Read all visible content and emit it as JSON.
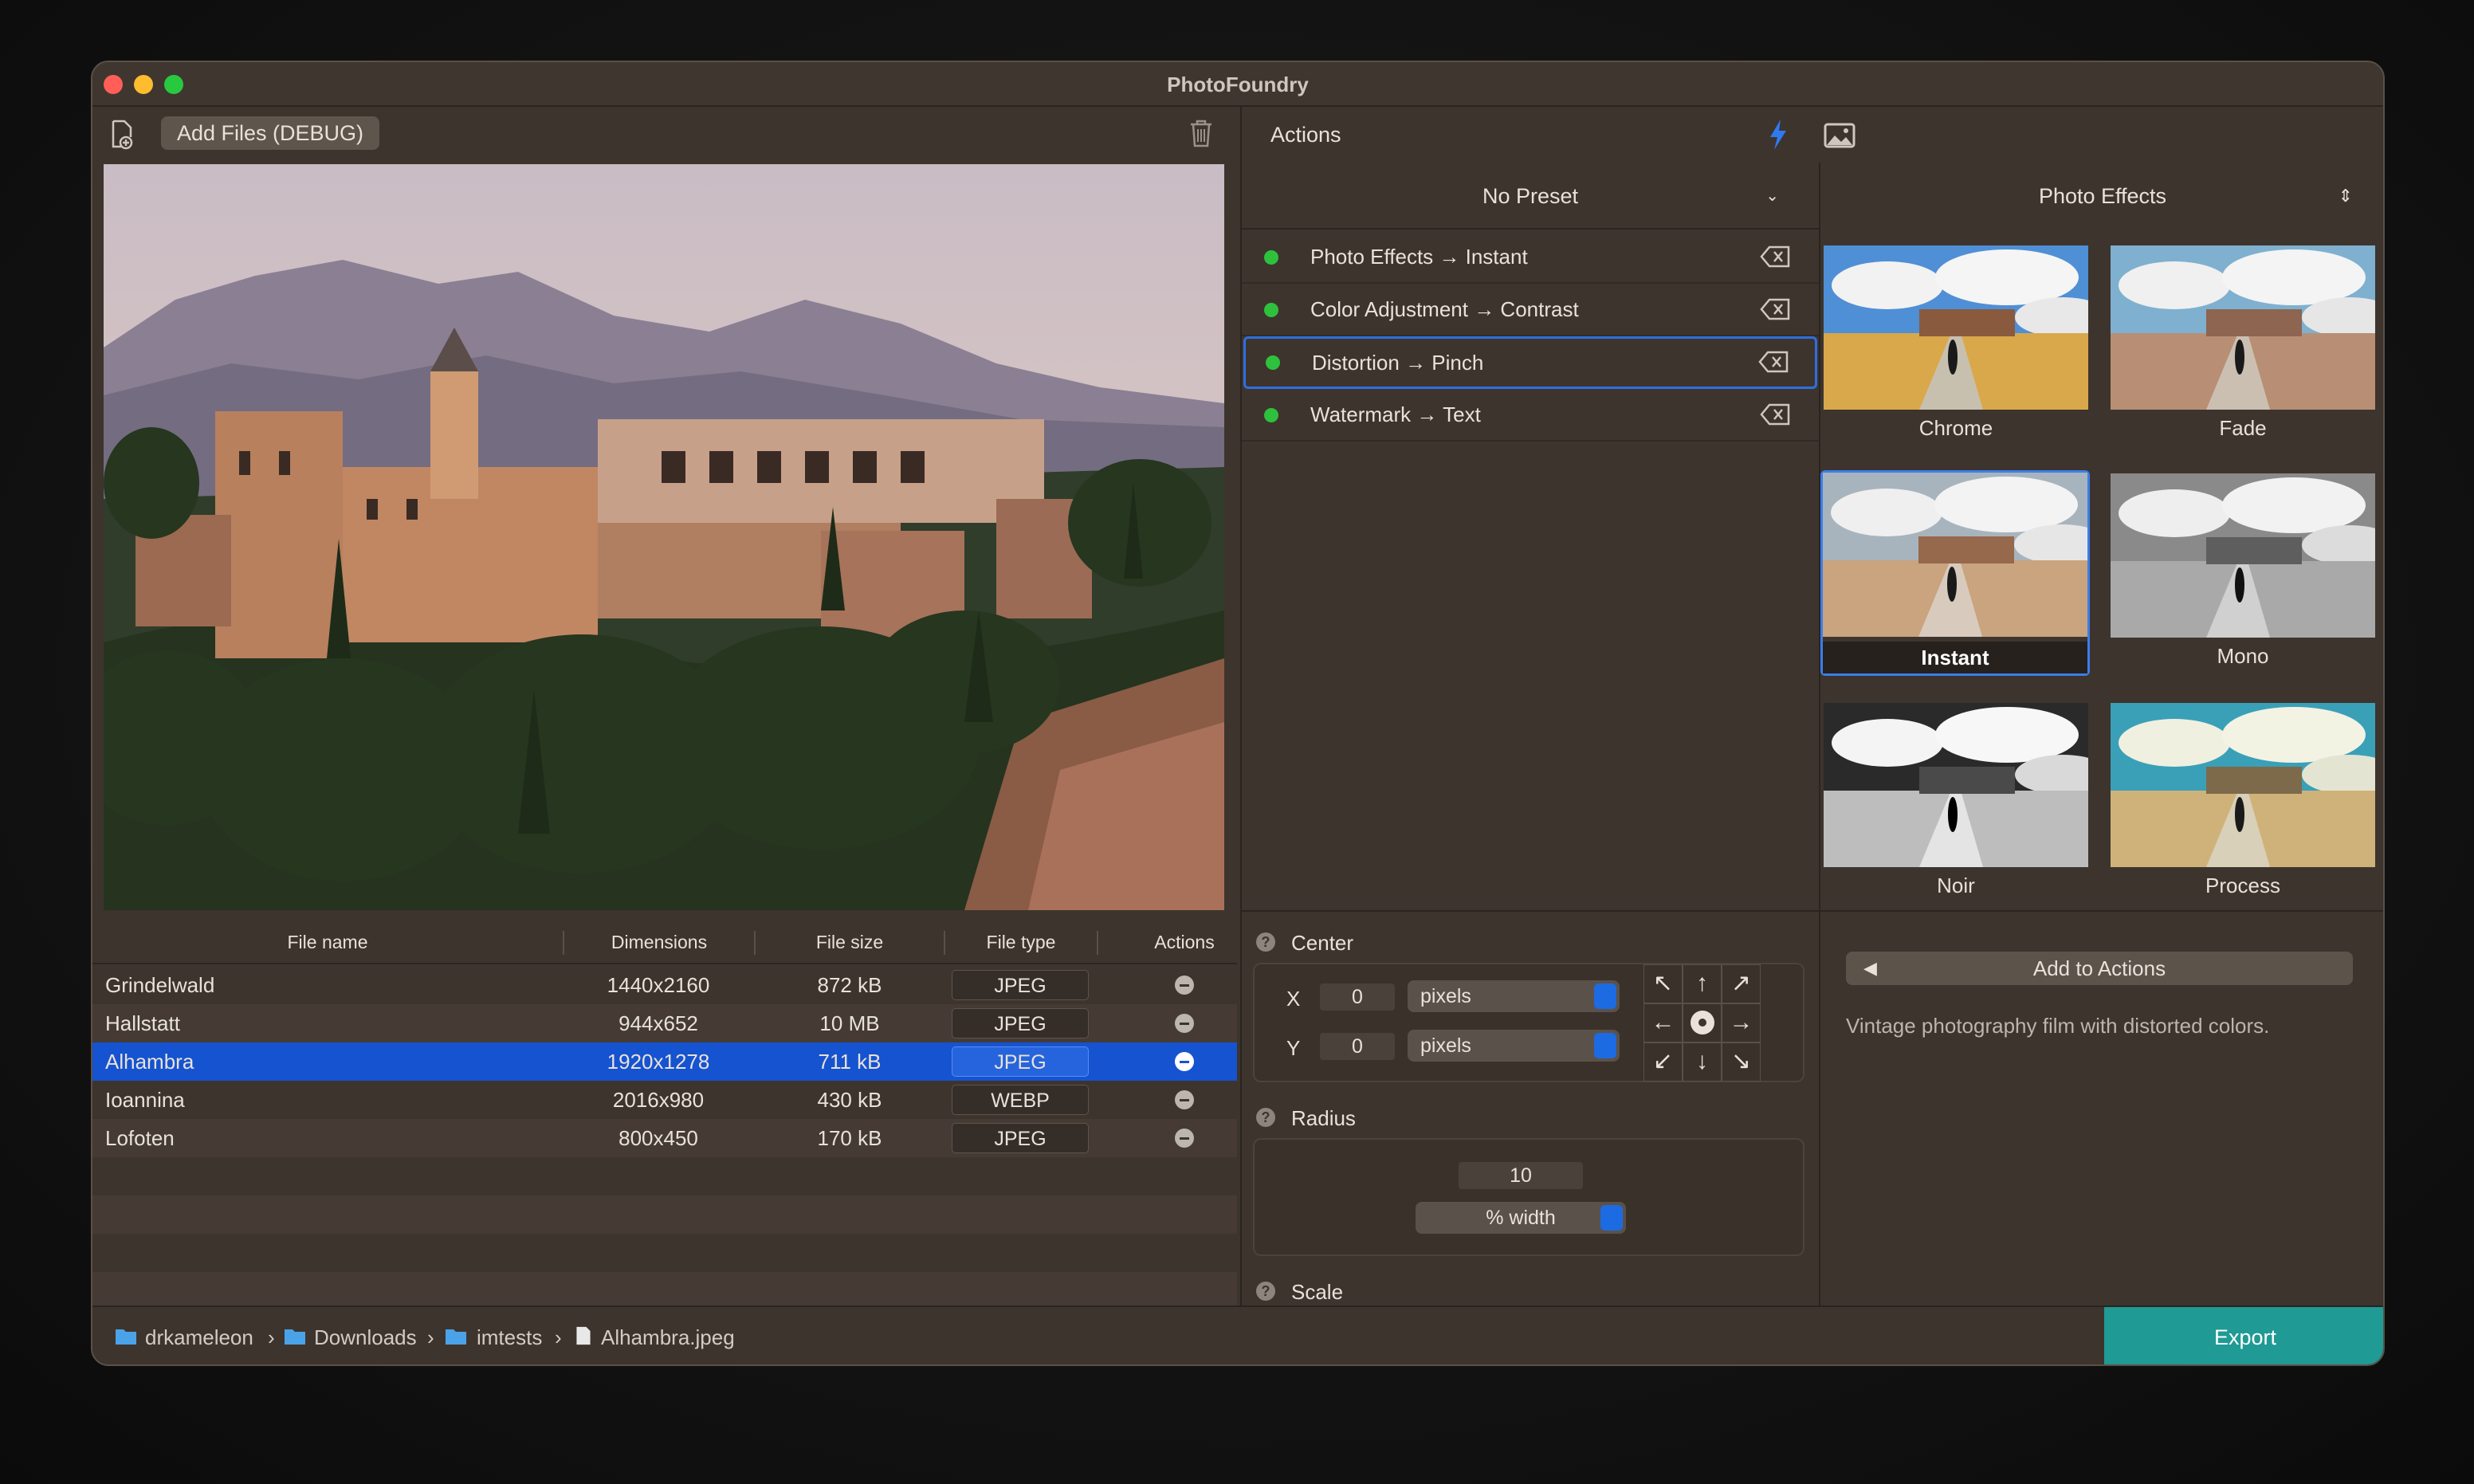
{
  "window": {
    "title": "PhotoFoundry"
  },
  "toolbar": {
    "add_files_label": "Add Files (DEBUG)"
  },
  "table": {
    "columns": [
      "File name",
      "Dimensions",
      "File size",
      "File type",
      "Actions"
    ],
    "rows": [
      {
        "name": "Grindelwald",
        "dimensions": "1440x2160",
        "size": "872 kB",
        "type": "JPEG"
      },
      {
        "name": "Hallstatt",
        "dimensions": "944x652",
        "size": "10 MB",
        "type": "JPEG"
      },
      {
        "name": "Alhambra",
        "dimensions": "1920x1278",
        "size": "711 kB",
        "type": "JPEG"
      },
      {
        "name": "Ioannina",
        "dimensions": "2016x980",
        "size": "430 kB",
        "type": "WEBP"
      },
      {
        "name": "Lofoten",
        "dimensions": "800x450",
        "size": "170 kB",
        "type": "JPEG"
      }
    ]
  },
  "actions": {
    "title": "Actions",
    "preset": "No Preset",
    "items": [
      "Photo Effects → Instant",
      "Color Adjustment → Contrast",
      "Distortion → Pinch",
      "Watermark → Text"
    ]
  },
  "effects": {
    "category": "Photo Effects",
    "thumbs": [
      "Chrome",
      "Fade",
      "Instant",
      "Mono",
      "Noir",
      "Process"
    ],
    "add_label": "Add to Actions",
    "description": "Vintage photography film with distorted colors."
  },
  "params": {
    "center_label": "Center",
    "x_label": "X",
    "x_value": "0",
    "x_unit": "pixels",
    "y_label": "Y",
    "y_value": "0",
    "y_unit": "pixels",
    "radius_label": "Radius",
    "radius_value": "10",
    "radius_unit": "% width",
    "scale_label": "Scale",
    "help_glyph": "?"
  },
  "breadcrumb": [
    "drkameleon",
    "Downloads",
    "imtests",
    "Alhambra.jpeg"
  ],
  "export_label": "Export",
  "colors": {
    "accent": "#1553d0",
    "export": "#1f9a94",
    "status_dot": "#2ec13d"
  }
}
